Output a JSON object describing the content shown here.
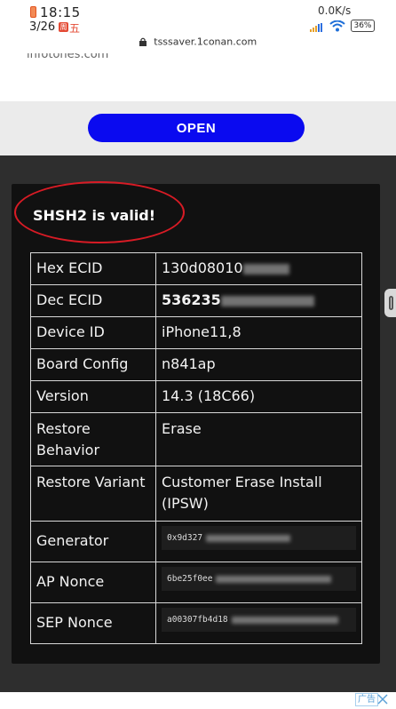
{
  "status_bar": {
    "time": "18:15",
    "date": "3/26",
    "weekday_badge": "周",
    "weekday": "五",
    "net_speed": "0.0K/s",
    "battery": "36%"
  },
  "browser": {
    "url": "tsssaver.1conan.com"
  },
  "page": {
    "partial_text": "infotones.com",
    "open_button": "OPEN",
    "result_title": "SHSH2 is valid!",
    "rows": [
      {
        "label": "Hex ECID",
        "value": "130d08010"
      },
      {
        "label": "Dec ECID",
        "value": "536235"
      },
      {
        "label": "Device ID",
        "value": "iPhone11,8"
      },
      {
        "label": "Board Config",
        "value": "n841ap"
      },
      {
        "label": "Version",
        "value": "14.3 (18C66)"
      },
      {
        "label": "Restore Behavior",
        "value": "Erase"
      },
      {
        "label": "Restore Variant",
        "value": "Customer Erase Install (IPSW)"
      },
      {
        "label": "Generator",
        "value": "0x9d327"
      },
      {
        "label": "AP Nonce",
        "value": "6be25f0ee"
      },
      {
        "label": "SEP Nonce",
        "value": "a00307fb4d18"
      }
    ]
  },
  "ad": {
    "label": "广告"
  },
  "colors": {
    "open_button": "#0a0af0",
    "card_bg": "#111111",
    "section_bg": "#2e2e2e",
    "highlight_circle": "#d81b25"
  }
}
